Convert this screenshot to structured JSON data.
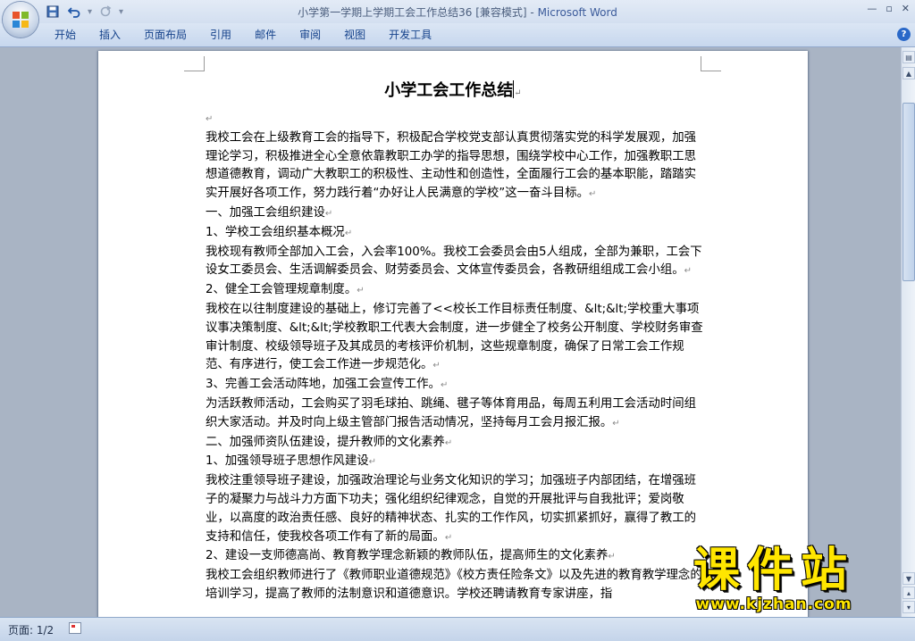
{
  "window": {
    "title_doc": "小学第一学期上学期工会工作总结36 [兼容模式]",
    "title_sep": " - ",
    "title_app": "Microsoft Word",
    "minimize": "—",
    "restore": "▫",
    "close": "✕"
  },
  "qat": {
    "save_icon": "save-icon",
    "undo_icon": "undo-icon",
    "redo_icon": "redo-icon",
    "customize_icon": "customize-icon"
  },
  "ribbon": {
    "tabs": [
      {
        "label": "开始"
      },
      {
        "label": "插入"
      },
      {
        "label": "页面布局"
      },
      {
        "label": "引用"
      },
      {
        "label": "邮件"
      },
      {
        "label": "审阅"
      },
      {
        "label": "视图"
      },
      {
        "label": "开发工具"
      }
    ],
    "help": "?"
  },
  "document": {
    "title": "小学工会工作总结",
    "paragraphs": [
      "",
      "我校工会在上级教育工会的指导下，积极配合学校党支部认真贯彻落实党的科学发展观，加强理论学习，积极推进全心全意依靠教职工办学的指导思想，围绕学校中心工作，加强教职工思想道德教育，调动广大教职工的积极性、主动性和创造性，全面履行工会的基本职能，踏踏实实开展好各项工作，努力践行着“办好让人民满意的学校”这一奋斗目标。",
      "一、加强工会组织建设",
      "1、学校工会组织基本概况",
      "我校现有教师全部加入工会，入会率100%。我校工会委员会由5人组成，全部为兼职，工会下设女工委员会、生活调解委员会、财劳委员会、文体宣传委员会，各教研组组成工会小组。",
      "2、健全工会管理规章制度。",
      "我校在以往制度建设的基础上，修订完善了<<校长工作目标责任制度、&lt;&lt;学校重大事项议事决策制度、&lt;&lt;学校教职工代表大会制度，进一步健全了校务公开制度、学校财务审查审计制度、校级领导班子及其成员的考核评价机制，这些规章制度，确保了日常工会工作规范、有序进行，使工会工作进一步规范化。",
      "3、完善工会活动阵地，加强工会宣传工作。",
      "为活跃教师活动，工会购买了羽毛球拍、跳绳、毽子等体育用品，每周五利用工会活动时间组织大家活动。并及时向上级主管部门报告活动情况，坚持每月工会月报汇报。",
      "二、加强师资队伍建设，提升教师的文化素养",
      "1、加强领导班子思想作风建设",
      "我校注重领导班子建设，加强政治理论与业务文化知识的学习；加强班子内部团结，在增强班子的凝聚力与战斗力方面下功夫；强化组织纪律观念，自觉的开展批评与自我批评；爱岗敬业，以高度的政治责任感、良好的精神状态、扎实的工作作风，切实抓紧抓好，赢得了教工的支持和信任，使我校各项工作有了新的局面。",
      "2、建设一支师德高尚、教育教学理念新颖的教师队伍，提高师生的文化素养",
      "我校工会组织教师进行了《教师职业道德规范》《校方责任险条文》以及先进的教育教学理念的培训学习，提高了教师的法制意识和道德意识。学校还聘请教育专家讲座，指"
    ]
  },
  "statusbar": {
    "page": "页面: 1/2"
  },
  "watermark": {
    "text": "课件站",
    "url": "www.kjzhan.com"
  },
  "colors": {
    "title_text": "#4b5e7d",
    "app_name": "#3a5a9a",
    "tab_text": "#15428b",
    "watermark": "#ffe600"
  }
}
